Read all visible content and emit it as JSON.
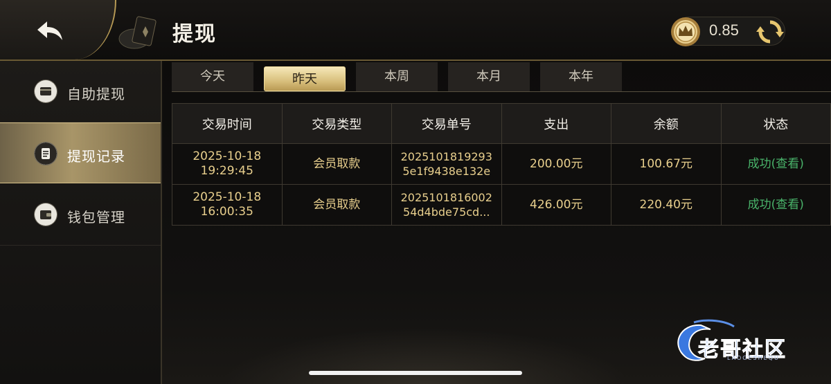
{
  "header": {
    "title": "提现",
    "back_icon": "back-arrow-icon",
    "balance": "0.85",
    "refresh_icon": "refresh-icon",
    "coin_icon": "crown-coin-icon"
  },
  "sidebar": {
    "items": [
      {
        "label": "自助提现",
        "icon": "card-icon",
        "active": false
      },
      {
        "label": "提现记录",
        "icon": "record-icon",
        "active": true
      },
      {
        "label": "钱包管理",
        "icon": "wallet-icon",
        "active": false
      }
    ]
  },
  "tabs": [
    {
      "label": "今天",
      "active": false
    },
    {
      "label": "昨天",
      "active": true
    },
    {
      "label": "本周",
      "active": false
    },
    {
      "label": "本月",
      "active": false
    },
    {
      "label": "本年",
      "active": false
    }
  ],
  "table": {
    "headers": [
      "交易时间",
      "交易类型",
      "交易单号",
      "支出",
      "余额",
      "状态"
    ],
    "rows": [
      {
        "time": "2025-10-18\n19:29:45",
        "type": "会员取款",
        "order": "2025101819293\n5e1f9438e132e",
        "amount": "200.00元",
        "balance": "100.67元",
        "status": "成功(查看)"
      },
      {
        "time": "2025-10-18\n16:00:35",
        "type": "会员取款",
        "order": "2025101816002\n54d4bde75cd...",
        "amount": "426.00元",
        "balance": "220.40元",
        "status": "成功(查看)"
      }
    ]
  },
  "watermark": {
    "text": "老哥社区",
    "sub": "LAOGESHEQU"
  },
  "colors": {
    "accent_gold": "#d8bf7c",
    "value_gold": "#e8cf8d",
    "success_green": "#49b36a"
  }
}
